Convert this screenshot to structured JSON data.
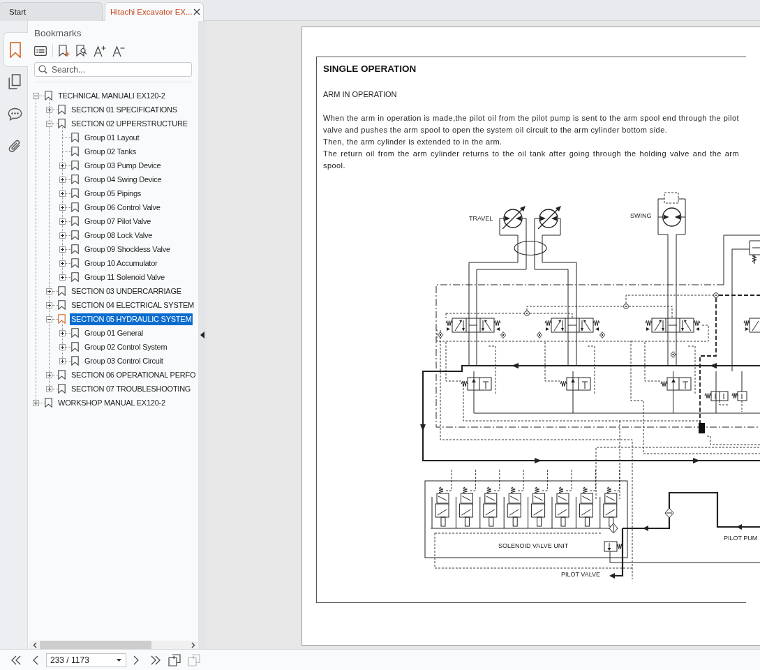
{
  "tabs": [
    {
      "label": "Start",
      "selected": false
    },
    {
      "label": "Hitachi Excavator EX...",
      "selected": true
    }
  ],
  "side_rail": [
    {
      "kind": "bookmarks",
      "selected": true
    },
    {
      "kind": "pages",
      "selected": false
    },
    {
      "kind": "comments",
      "selected": false
    },
    {
      "kind": "attachments",
      "selected": false
    }
  ],
  "bookmarks_panel": {
    "title": "Bookmarks",
    "search": {
      "placeholder": "Search..."
    },
    "tree": [
      {
        "label": "TECHNICAL MANUALI EX120-2",
        "expanded": true,
        "selected": false,
        "children": [
          {
            "label": "SECTION 01 SPECIFICATIONS",
            "expanded": false,
            "selected": false
          },
          {
            "label": "SECTION 02 UPPERSTRUCTURE",
            "expanded": true,
            "selected": false,
            "children": [
              {
                "label": "Group 01 Layout",
                "selected": false
              },
              {
                "label": "Group 02 Tanks",
                "selected": false
              },
              {
                "label": "Group 03 Pump Device",
                "expanded": false,
                "selected": false
              },
              {
                "label": "Group 04 Swing Device",
                "expanded": false,
                "selected": false
              },
              {
                "label": "Group 05 Pipings",
                "expanded": false,
                "selected": false
              },
              {
                "label": "Group 06 Control Valve",
                "expanded": false,
                "selected": false
              },
              {
                "label": "Group 07 Pilot Valve",
                "expanded": false,
                "selected": false
              },
              {
                "label": "Group 08 Lock Valve",
                "expanded": false,
                "selected": false
              },
              {
                "label": "Group 09 Shockless Valve",
                "expanded": false,
                "selected": false
              },
              {
                "label": "Group 10 Accumulator",
                "expanded": false,
                "selected": false
              },
              {
                "label": "Group 11 Solenoid Valve",
                "expanded": false,
                "selected": false
              }
            ]
          },
          {
            "label": "SECTION 03 UNDERCARRIAGE",
            "expanded": false,
            "selected": false
          },
          {
            "label": "SECTION 04 ELECTRICAL SYSTEM",
            "expanded": false,
            "selected": false
          },
          {
            "label": "SECTION 05 HYDRAULIC SYSTEM",
            "expanded": true,
            "selected": true,
            "children": [
              {
                "label": "Group 01 General",
                "expanded": false,
                "selected": false
              },
              {
                "label": "Group 02 Control System",
                "expanded": false,
                "selected": false
              },
              {
                "label": "Group 03 Control Circuit",
                "expanded": false,
                "selected": false
              }
            ]
          },
          {
            "label": "SECTION 06 OPERATIONAL PERFO",
            "expanded": false,
            "selected": false
          },
          {
            "label": "SECTION 07 TROUBLESHOOTING",
            "expanded": false,
            "selected": false
          }
        ]
      },
      {
        "label": "WORKSHOP MANUAL EX120-2",
        "expanded": false,
        "selected": false
      }
    ]
  },
  "document": {
    "title": "SINGLE OPERATION",
    "subtitle": "ARM IN OPERATION",
    "paragraphs": [
      "When the arm in operation is made,the pilot oil from the pilot pump is sent to the arm spool end through the pilot valve and pushes the arm spool to open the system oil circuit to the arm cylinder bottom side.",
      "Then, the arm cylinder is extended to in the arm.",
      "The return oil from the arm cylinder returns to the oil tank after going through the holding valve and the arm spool."
    ],
    "diagram_labels": {
      "travel": "TRAVEL",
      "swing": "SWING",
      "solenoid_unit": "SOLENOID VALVE UNIT",
      "pilot_valve": "PILOT VALVE",
      "pilot_pump": "PILOT PUM"
    }
  },
  "page_nav": {
    "value": "233 / 1173",
    "view_buttons": [
      {
        "disabled": false
      },
      {
        "disabled": true
      }
    ]
  }
}
